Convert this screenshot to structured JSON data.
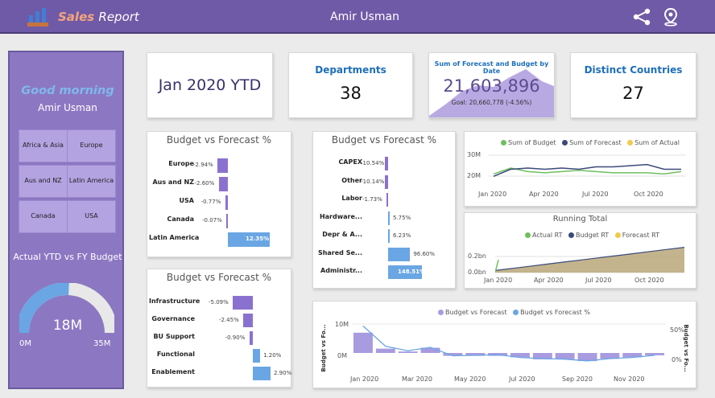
{
  "header": {
    "title_part1": "Sales",
    "title_part2": "Report",
    "user": "Amir Usman"
  },
  "sidebar": {
    "greeting": "Good morning",
    "user": "Amir Usman",
    "regions": [
      "Africa & Asia",
      "Europe",
      "Aus and NZ",
      "Latin America",
      "Canada",
      "USA"
    ],
    "gauge": {
      "title": "Actual YTD vs FY Budget",
      "value_label": "18M",
      "min_label": "0M",
      "max_label": "35M",
      "value": 18,
      "min": 0,
      "max": 35
    }
  },
  "kpis": {
    "period": "Jan 2020 YTD",
    "departments_title": "Departments",
    "departments_value": "38",
    "forecast_title": "Sum of Forecast and Budget by Date",
    "forecast_value": "21,603,896",
    "forecast_goal": "Goal: 20,660,778 (-4.56%)",
    "countries_title": "Distinct Countries",
    "countries_value": "27"
  },
  "colors": {
    "purple": "#8b71cf",
    "blue": "#6aa6e3",
    "budget": "#6fbf5f",
    "forecast": "#3b4a7a",
    "actual": "#f2c94c"
  },
  "chart_data": [
    {
      "type": "bar",
      "title": "Budget vs Forecast %",
      "categories": [
        "Europe",
        "Aus and NZ",
        "USA",
        "Canada",
        "Latin America"
      ],
      "values": [
        -2.94,
        -2.6,
        -0.77,
        -0.07,
        12.35
      ],
      "labels": [
        "-2.94%",
        "-2.60%",
        "-0.77%",
        "-0.07%",
        "12.35%"
      ]
    },
    {
      "type": "bar",
      "title": "Budget vs Forecast %",
      "categories": [
        "Infrastructure",
        "Governance",
        "BU Support",
        "Functional",
        "Enablement"
      ],
      "values": [
        -5.09,
        -2.45,
        -0.9,
        1.2,
        2.9
      ],
      "labels": [
        "-5.09%",
        "-2.45%",
        "-0.90%",
        "1.20%",
        "2.90%"
      ]
    },
    {
      "type": "bar",
      "title": "Budget vs Forecast %",
      "categories": [
        "CAPEX",
        "Other",
        "Labor",
        "Hardware...",
        "Depr & A...",
        "Shared Se...",
        "Administr..."
      ],
      "values": [
        -10.54,
        -10.14,
        -1.73,
        5.75,
        6.23,
        96.6,
        148.51
      ],
      "labels": [
        "-10.54%",
        "-10.14%",
        "-1.73%",
        "5.75%",
        "6.23%",
        "96.60%",
        "148.51%"
      ]
    },
    {
      "type": "line",
      "legend": [
        "Sum of Budget",
        "Sum of Forecast",
        "Sum of Actual"
      ],
      "x_ticks": [
        "Jan 2020",
        "Apr 2020",
        "Jul 2020",
        "Oct 2020"
      ],
      "y_ticks": [
        "30M",
        "20M"
      ],
      "series": [
        {
          "name": "Sum of Budget",
          "values": [
            21,
            23.5,
            22,
            21.5,
            22,
            22.5,
            22,
            21.5,
            21.5,
            21.5,
            21,
            22
          ]
        },
        {
          "name": "Sum of Forecast",
          "values": [
            20,
            23,
            23.5,
            23,
            23.5,
            23,
            24,
            24,
            24.5,
            25,
            23,
            23
          ]
        }
      ]
    },
    {
      "type": "area",
      "title": "Running Total",
      "legend": [
        "Actual RT",
        "Budget RT",
        "Forecast RT"
      ],
      "x_ticks": [
        "Jan 2020",
        "Apr 2020",
        "Jul 2020",
        "Oct 2020"
      ],
      "y_ticks": [
        "0.2bn",
        "0.0bn"
      ],
      "series": [
        {
          "name": "Forecast RT",
          "values": [
            0.02,
            0.04,
            0.06,
            0.08,
            0.1,
            0.12,
            0.14,
            0.16,
            0.18,
            0.2,
            0.22,
            0.24
          ]
        },
        {
          "name": "Budget RT",
          "values": [
            0.02,
            0.04,
            0.06,
            0.08,
            0.1,
            0.12,
            0.14,
            0.16,
            0.18,
            0.2,
            0.22,
            0.24
          ]
        }
      ]
    },
    {
      "type": "bar",
      "legend": [
        "Budget vs Forecast",
        "Budget vs Forecast %"
      ],
      "x_ticks": [
        "Jan 2020",
        "Mar 2020",
        "May 2020",
        "Jul 2020",
        "Sep 2020",
        "Nov 2020"
      ],
      "y_ticks_left": [
        "10M",
        "0M"
      ],
      "y_ticks_right": [
        "50%",
        "0%"
      ],
      "ylabel_left": "Budget vs Fo...",
      "ylabel_right": "Budget vs Fo...",
      "series": [
        {
          "name": "Budget vs Forecast",
          "values": [
            7,
            1.5,
            0.5,
            1.8,
            -1,
            -1,
            -1,
            -1.5,
            -2.2,
            -2.2,
            -2.8,
            -2,
            -1.5,
            -0.8
          ]
        },
        {
          "name": "Budget vs Forecast %",
          "values": [
            48,
            12,
            4,
            10,
            -5,
            -4,
            -3,
            -8,
            -10,
            -11,
            -14,
            -10,
            -8,
            -4
          ]
        }
      ]
    }
  ]
}
